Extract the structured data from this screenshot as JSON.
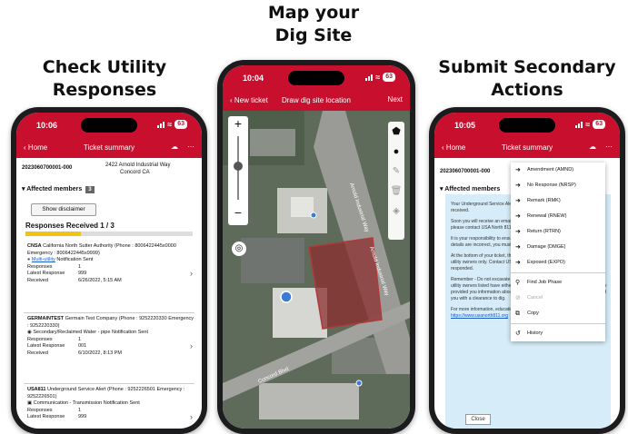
{
  "headings": {
    "left": [
      "Check Utility",
      "Responses"
    ],
    "center": [
      "Map your",
      "Dig Site"
    ],
    "right": [
      "Submit Secondary",
      "Actions"
    ]
  },
  "colors": {
    "brand_red": "#c8102e",
    "progress": "#f1c40f",
    "map_shade": "#8b2e2e"
  },
  "left_phone": {
    "status": {
      "time": "10:06",
      "battery": "63"
    },
    "nav": {
      "back": "Home",
      "title": "Ticket summary"
    },
    "ticket": {
      "number": "2023060700001-000",
      "address_line1": "2422 Arnold Industrial Way",
      "address_line2": "Concord CA"
    },
    "affected_label": "Affected members",
    "affected_count": "3",
    "disclaimer_button": "Show disclaimer",
    "responses_title": "Responses Received 1 / 3",
    "progress": 0.33,
    "members": [
      {
        "name": "CNSA",
        "full_name": "California North Sutter Authority (Phone : 8006422445x0000 Emergency : 8006422445x9999)",
        "facility": "Multi-utility",
        "status": "Notification Sent",
        "rows": [
          {
            "k": "Responses",
            "v": "1"
          },
          {
            "k": "Latest Response",
            "v": "999"
          },
          {
            "k": "Received",
            "v": "6/26/2022, 5:15 AM"
          }
        ]
      },
      {
        "name": "GERMAINTEST",
        "full_name": "Germain Test Company (Phone : 9252220330 Emergency : 9252220330)",
        "facility": "Secondary/Reclaimed Water - pipe",
        "status": "Notification Sent",
        "rows": [
          {
            "k": "Responses",
            "v": "1"
          },
          {
            "k": "Latest Response",
            "v": "001"
          },
          {
            "k": "Received",
            "v": "6/10/2022, 8:13 PM"
          }
        ]
      },
      {
        "name": "USA811",
        "full_name": "Underground Service Alert (Phone : 9252226501 Emergency : 9252226501)",
        "facility": "Communication - Transmission",
        "status": "Notification Sent",
        "rows": [
          {
            "k": "Responses",
            "v": "1"
          },
          {
            "k": "Latest Response",
            "v": "999"
          }
        ]
      }
    ]
  },
  "center_phone": {
    "status": {
      "time": "10:04",
      "battery": "63"
    },
    "nav": {
      "back": "New ticket",
      "title": "Draw dig site location",
      "next": "Next"
    },
    "map_labels": [
      "Arnold Industrial Way",
      "Arnold Industrial Way",
      "Concord Blvd"
    ]
  },
  "right_phone": {
    "status": {
      "time": "10:05",
      "battery": "63"
    },
    "nav": {
      "back": "Home",
      "title": "Ticket summary"
    },
    "ticket_number": "2023060700001-000",
    "affected_label": "Affected members",
    "menu": [
      {
        "label": "Amendment (AMND)",
        "icon": "arrow-right-icon",
        "disabled": false
      },
      {
        "label": "No Response (NRSP)",
        "icon": "arrow-right-icon",
        "disabled": false
      },
      {
        "label": "Remark (RMK)",
        "icon": "arrow-right-icon",
        "disabled": false
      },
      {
        "label": "Renewal (RNEW)",
        "icon": "arrow-right-icon",
        "disabled": false
      },
      {
        "label": "Return (RTRN)",
        "icon": "arrow-right-icon",
        "disabled": false
      },
      {
        "label": "Damage (DMGE)",
        "icon": "arrow-right-icon",
        "disabled": false
      },
      {
        "label": "Exposed (EXPO)",
        "icon": "arrow-right-icon",
        "disabled": false
      },
      {
        "label": "Find Job Phase",
        "icon": "search-icon",
        "disabled": false
      },
      {
        "label": "Cancel",
        "icon": "cancel-icon",
        "disabled": true
      },
      {
        "label": "Copy",
        "icon": "copy-icon",
        "disabled": false
      },
      {
        "label": "History",
        "icon": "history-icon",
        "disabled": false
      }
    ],
    "info": {
      "p1": "Your Underground Service Alert of Northern California Ticket has been received.",
      "p2": "Soon you will receive an email with a PDF. If you did not, review your ticket, please contact USA North 811 at 800-642-2444.",
      "p3": "It is your responsibility to ensure the ticket are accurate. If the area or time details are incorrect, you must correct or amend your ticket as necessary.",
      "p4": "At the bottom of your ticket, these owners being notified. Note that these are utility owners only. Contact USA North 811 to confirm that all owners have responded.",
      "p5": "Remember - Do not excavate until you have received a response from all utility owners listed have either marked the location of their facilities, OR have provided you information about the location of their assets, OR have provided you with a clearance to dig.",
      "p6a": "For more information, education, or training please visit our website:",
      "p6b": "https://www.usanorth811.org",
      "close": "Close"
    }
  }
}
